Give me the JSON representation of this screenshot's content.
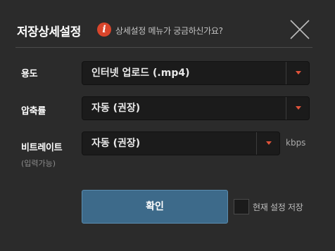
{
  "header": {
    "title": "저장상세설정",
    "info_icon": "info-icon",
    "info_glyph": "i",
    "help_text": "상세설정 메뉴가 궁금하신가요?",
    "close_icon": "close-icon"
  },
  "fields": {
    "usage": {
      "label": "용도",
      "value": "인터넷 업로드 (.mp4)"
    },
    "compression": {
      "label": "압축률",
      "value": "자동 (권장)"
    },
    "bitrate": {
      "label": "비트레이트",
      "sub_label": "(입력가능)",
      "value": "자동 (권장)",
      "unit": "kbps"
    }
  },
  "footer": {
    "confirm_label": "확인",
    "save_settings_label": "현재 설정 저장",
    "save_settings_checked": false
  },
  "colors": {
    "background": "#2b2b2b",
    "accent_red": "#d9452b",
    "button_blue": "#3d6a8a"
  }
}
